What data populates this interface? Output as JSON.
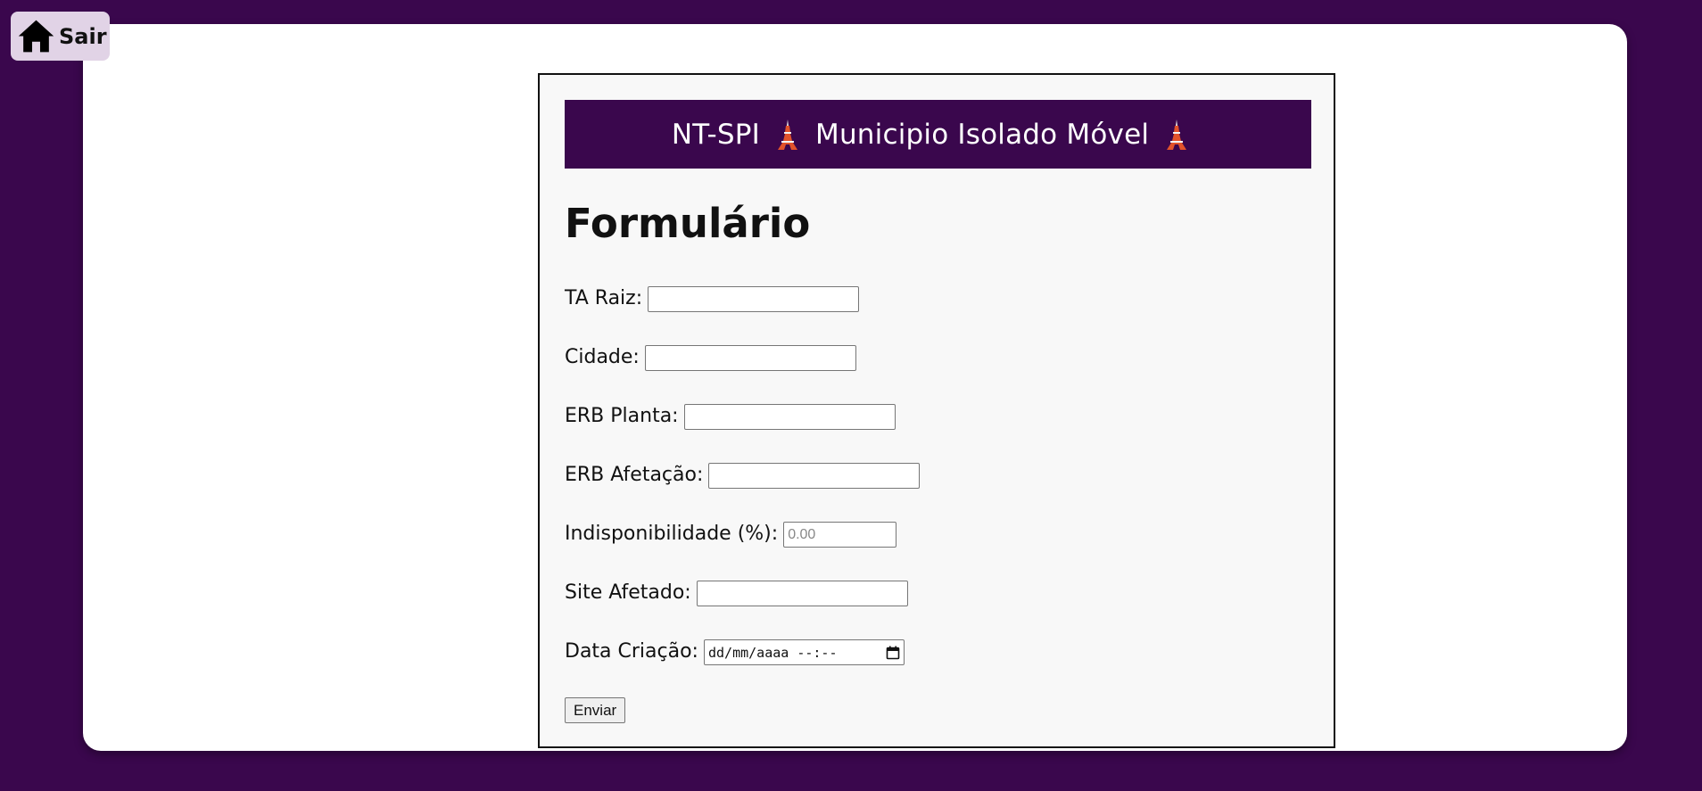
{
  "nav": {
    "home_label": "Sair",
    "home_icon": "home-icon"
  },
  "banner": {
    "left_text": "NT-SPI",
    "middle_text": "Municipio Isolado Móvel",
    "icon": "tokyo-tower-icon"
  },
  "form": {
    "title": "Formulário",
    "fields": [
      {
        "label": "TA Raiz:",
        "type": "text",
        "value": "",
        "placeholder": ""
      },
      {
        "label": "Cidade:",
        "type": "text",
        "value": "",
        "placeholder": ""
      },
      {
        "label": "ERB Planta:",
        "type": "text",
        "value": "",
        "placeholder": ""
      },
      {
        "label": "ERB Afetação:",
        "type": "text",
        "value": "",
        "placeholder": ""
      },
      {
        "label": "Indisponibilidade (%):",
        "type": "number",
        "value": "",
        "placeholder": "0.00"
      },
      {
        "label": "Site Afetado:",
        "type": "text",
        "value": "",
        "placeholder": ""
      },
      {
        "label": "Data Criação:",
        "type": "datetime-local",
        "value": "",
        "display": "dd/mm/aaaa --:--"
      }
    ],
    "submit_label": "Enviar"
  },
  "colors": {
    "background": "#3a074d",
    "banner": "#3a074d",
    "card": "#ffffff",
    "form_bg": "#f8f8f8",
    "home_button": "#e1d3e6"
  }
}
